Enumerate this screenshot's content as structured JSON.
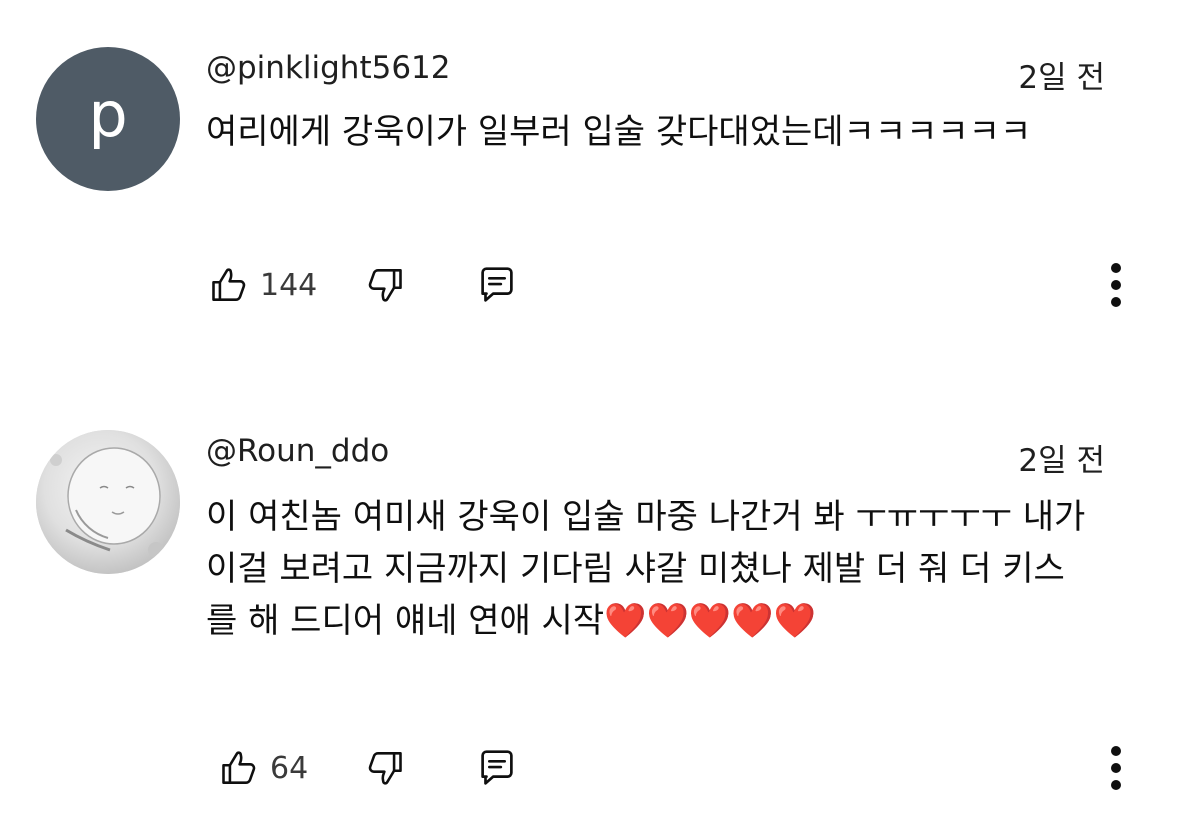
{
  "comments": [
    {
      "avatar_letter": "p",
      "avatar_color": "#4f5b66",
      "handle": "@pinklight5612",
      "time": "2일 전",
      "text": "여리에게 강욱이가 일부러 입술 갖다대었는데ㅋㅋㅋㅋㅋㅋ",
      "likes": "144"
    },
    {
      "avatar_letter": "",
      "handle": "@Roun_ddo",
      "time": "2일 전",
      "text": "이 여친놈 여미새 강욱이 입술 마중 나간거 봐 ㅜㅠㅜㅜㅜ 내가 이걸 보려고 지금까지 기다림 샤갈 미쳤나 제발 더 줘 더 키스를 해 드디어 얘네 연애 시작❤️❤️❤️❤️❤️",
      "likes": "64"
    }
  ],
  "icons": {
    "like": "thumbs-up-icon",
    "dislike": "thumbs-down-icon",
    "reply": "reply-icon",
    "more": "more-vertical-icon"
  }
}
